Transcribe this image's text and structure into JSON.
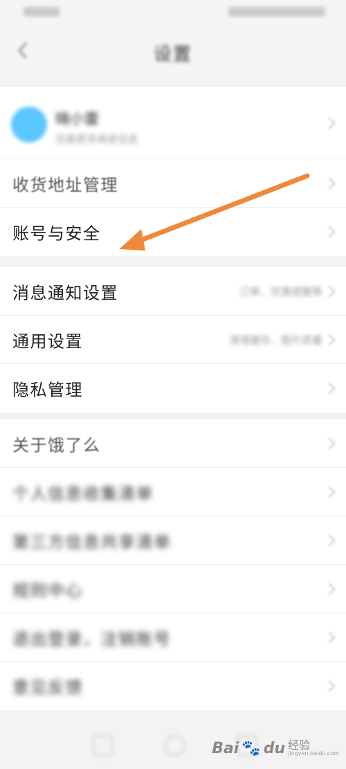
{
  "status_bar": {},
  "nav": {
    "title": "设置"
  },
  "profile": {
    "name": "晓小雷",
    "subtitle": "完善更多商家信息"
  },
  "section1": [
    {
      "label": "收货地址管理"
    },
    {
      "label": "账号与安全"
    }
  ],
  "section2": [
    {
      "label": "消息通知设置",
      "value": "订单、优惠提醒等"
    },
    {
      "label": "通用设置",
      "value": "清理缓存、图片质量"
    },
    {
      "label": "隐私管理"
    }
  ],
  "section3": [
    {
      "label": "关于饿了么"
    },
    {
      "label": "个人信息收集清单"
    },
    {
      "label": "第三方信息共享清单"
    },
    {
      "label": "规则中心"
    },
    {
      "label": "退出登录，注销账号"
    },
    {
      "label": "意见反馈"
    }
  ],
  "annotation": {
    "color": "#f0883a"
  },
  "watermark": {
    "brand": "Bai",
    "brand_suffix": "du",
    "cn": "经验",
    "url": "jingyan.baidu.com"
  }
}
